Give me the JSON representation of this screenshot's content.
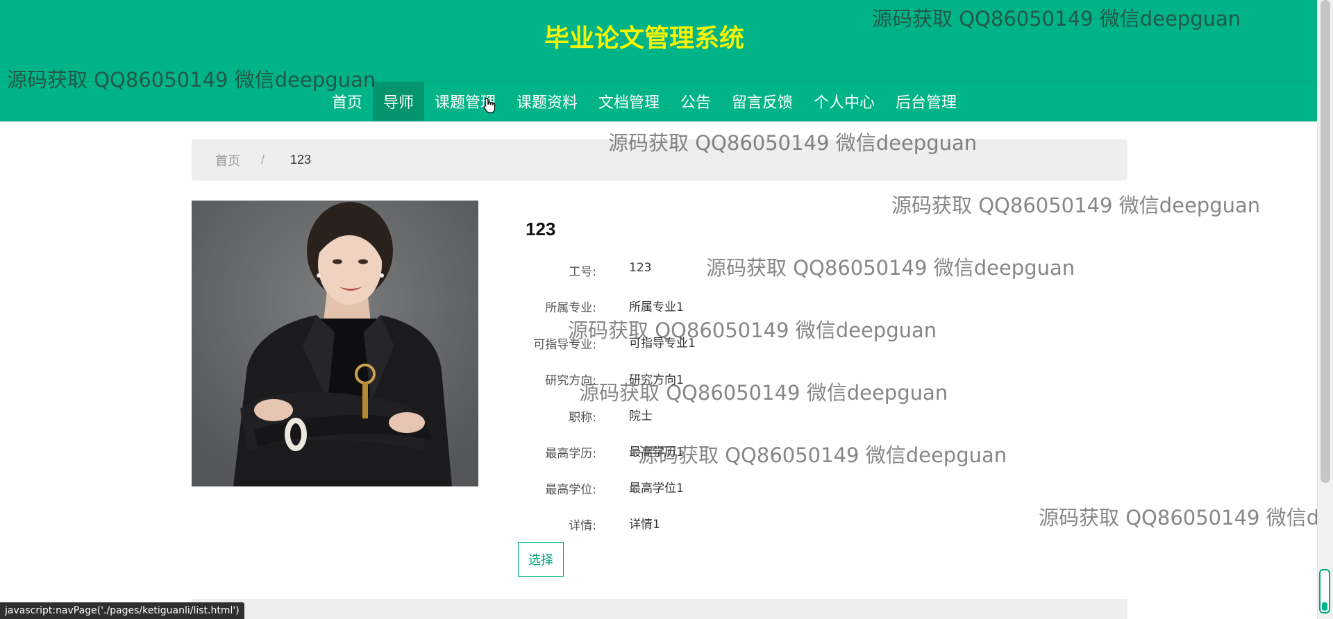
{
  "header": {
    "title": "毕业论文管理系统",
    "nav": [
      {
        "label": "首页",
        "active": false
      },
      {
        "label": "导师",
        "active": true
      },
      {
        "label": "课题管理",
        "active": false
      },
      {
        "label": "课题资料",
        "active": false
      },
      {
        "label": "文档管理",
        "active": false
      },
      {
        "label": "公告",
        "active": false
      },
      {
        "label": "留言反馈",
        "active": false
      },
      {
        "label": "个人中心",
        "active": false
      },
      {
        "label": "后台管理",
        "active": false
      }
    ]
  },
  "breadcrumb": {
    "home": "首页",
    "separator": "/",
    "current": "123"
  },
  "detail": {
    "name": "123",
    "fields": [
      {
        "label": "工号:",
        "value": "123"
      },
      {
        "label": "所属专业:",
        "value": "所属专业1"
      },
      {
        "label": "可指导专业:",
        "value": "可指导专业1"
      },
      {
        "label": "研究方向:",
        "value": "研究方向1"
      },
      {
        "label": "职称:",
        "value": "院士"
      },
      {
        "label": "最高学历:",
        "value": "最高学历1"
      },
      {
        "label": "最高学位:",
        "value": "最高学位1"
      },
      {
        "label": "详情:",
        "value": "详情1"
      }
    ],
    "select_label": "选择"
  },
  "watermark": "源码获取 QQ86050149 微信deepguan",
  "status_bar": "javascript:navPage('./pages/ketiguanli/list.html')",
  "colors": {
    "header_bg": "#00b487",
    "title": "#f8f400",
    "nav_active": "#04946f"
  }
}
